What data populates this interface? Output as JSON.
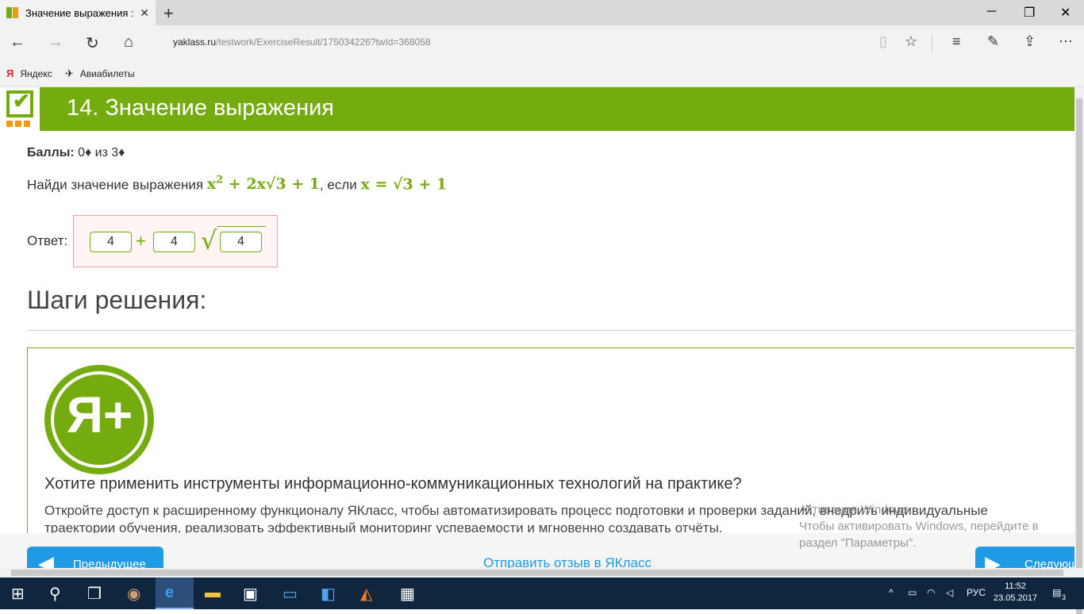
{
  "browser": {
    "tab_title": "Значение выражения :",
    "tab_close": "✕",
    "new_tab": "+",
    "url_domain": "yaklass.ru",
    "url_path": "/testwork/ExerciseResult/175034226?twId=368058",
    "bookmarks": [
      {
        "label": "Яндекс",
        "icon": "yandex-icon"
      },
      {
        "label": "Авиабилеты",
        "icon": "plane-icon"
      }
    ],
    "accent_color": "#74ab0e"
  },
  "page": {
    "title": "14. Значение выражения",
    "score_label": "Баллы:",
    "score_value": " 0♦ из 3♦",
    "task_text": "Найди значение выражения ",
    "task_expr": "x",
    "task_expr_sup": "2",
    "task_expr_rest": " + 2x√3 + 1",
    "task_mid": ", если ",
    "task_cond": "x = √3 + 1",
    "answer_label": "Ответ:",
    "answer_inputs": [
      "4",
      "4",
      "4"
    ],
    "plus_sign": "+",
    "radical_sign": "√",
    "steps_heading": "Шаги решения:"
  },
  "promo": {
    "logo_text": "Я+",
    "title": "Хотите применить инструменты информационно-коммуникационных технологий на практике?",
    "text": "Откройте доступ к расширенному функционалу ЯКласс, чтобы автоматизировать процесс подготовки и проверки заданий, внедрить индивидуальные траектории обучения, реализовать эффективный мониторинг успеваемости и мгновенно создавать отчёты."
  },
  "footer": {
    "prev_label": "Предыдущее",
    "next_label": "Следующ",
    "feedback_link": "Отправить отзыв в ЯКласс"
  },
  "watermark": {
    "line1": "Активация Windows",
    "line2": "Чтобы активировать Windows, перейдите в",
    "line3": "раздел \"Параметры\"."
  },
  "taskbar": {
    "lang": "РУС",
    "time": "11:52",
    "date": "23.05.2017",
    "notifications": "3"
  }
}
